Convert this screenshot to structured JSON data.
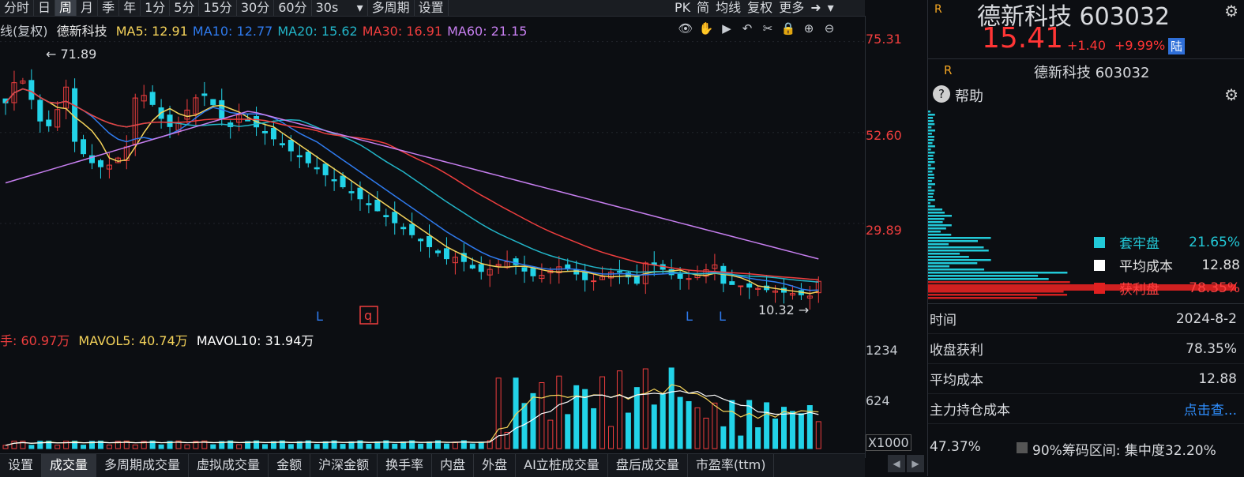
{
  "toolbar": {
    "tabs": [
      "分时",
      "日",
      "周",
      "月",
      "季",
      "年",
      "1分",
      "5分",
      "15分",
      "30分",
      "60分"
    ],
    "active_tab": "周",
    "select_value": "30s",
    "extra": [
      "多周期",
      "设置"
    ],
    "right": [
      "PK",
      "简",
      "均线",
      "复权",
      "更多"
    ]
  },
  "legend": {
    "prefix": "线(复权)",
    "name": "德新科技",
    "ma": [
      {
        "label": "MA5: 12.91",
        "color": "#f5d35a"
      },
      {
        "label": "MA10: 12.77",
        "color": "#2f7bef"
      },
      {
        "label": "MA20: 15.62",
        "color": "#22b5c8"
      },
      {
        "label": "MA30: 16.91",
        "color": "#ef3e3e"
      },
      {
        "label": "MA60: 21.15",
        "color": "#c77ff0"
      }
    ]
  },
  "price_axis": [
    "75.31",
    "52.60",
    "29.89"
  ],
  "annotations": {
    "high": "71.89",
    "low": "10.32",
    "markers": [
      "L",
      "L",
      "L"
    ],
    "q_marker": "q"
  },
  "vol_legend": {
    "vol": "手: 60.97万",
    "mavol5": "MAVOL5: 40.74万",
    "mavol10": "MAVOL10: 31.94万"
  },
  "vol_axis": [
    "1234",
    "624",
    "X1000"
  ],
  "bottom_tabs": [
    "设置",
    "成交量",
    "多周期成交量",
    "虚拟成交量",
    "金额",
    "沪深金额",
    "换手率",
    "内盘",
    "外盘",
    "AI立桩成交量",
    "盘后成交量",
    "市盈率(ttm)"
  ],
  "active_bottom": "成交量",
  "side": {
    "logo": "R",
    "title": "德新科技 603032",
    "price": "15.41",
    "change": "+1.40",
    "change_pct": "+9.99%",
    "exchange_badge": "陆",
    "sub_logo": "R",
    "sub_title": "德新科技 603032",
    "help": "帮助",
    "chip_legend": [
      {
        "label": "套牢盘",
        "value": "21.65%",
        "color": "#22c9d8",
        "text_color": "#22c9d8"
      },
      {
        "label": "平均成本",
        "value": "12.88",
        "color": "#ffffff",
        "text_color": "#e0e0e0"
      },
      {
        "label": "获利盘",
        "value": "78.35%",
        "color": "#e02020",
        "text_color": "#ff4040"
      }
    ],
    "info": [
      {
        "k": "时间",
        "v": "2024-8-2"
      },
      {
        "k": "收盘获利",
        "v": "78.35%"
      },
      {
        "k": "平均成本",
        "v": "12.88"
      },
      {
        "k": "主力持仓成本",
        "v": "点击查..."
      }
    ],
    "footer_left": "47.37%",
    "footer_right": "90%筹码区间: 集中度32.20%"
  },
  "colors": {
    "up": "#ef3e3e",
    "down": "#22d3e8",
    "bg": "#0c0e12"
  },
  "chart_data": {
    "type": "candlestick",
    "price_range": [
      10.32,
      71.89
    ],
    "ma_values": {
      "MA5": 12.91,
      "MA10": 12.77,
      "MA20": 15.62,
      "MA30": 16.91,
      "MA60": 21.15
    },
    "last_close": 15.41,
    "volume_unit": "X1000",
    "volume_last": 60.97,
    "volume_range": [
      0,
      1234
    ]
  }
}
